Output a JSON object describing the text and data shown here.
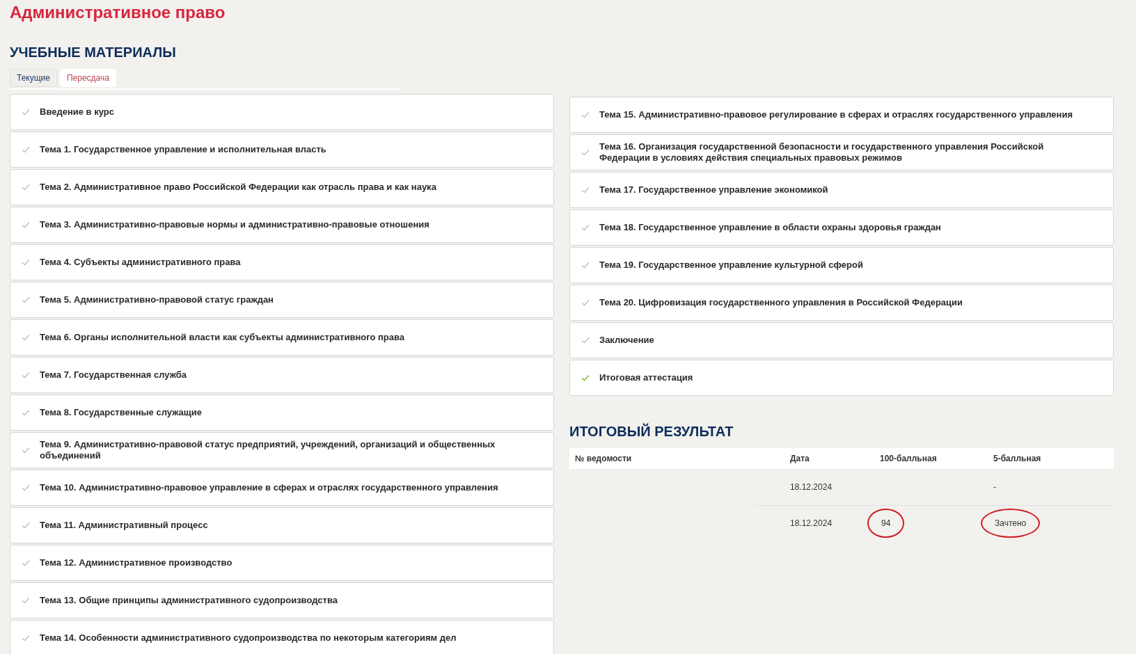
{
  "page_title": "Административное право",
  "materials": {
    "heading": "УЧЕБНЫЕ МАТЕРИАЛЫ",
    "tabs": [
      {
        "label": "Текущие",
        "selected": false
      },
      {
        "label": "Пересдача",
        "selected": true
      }
    ],
    "left_items": [
      {
        "title": "Введение в курс",
        "completed": false
      },
      {
        "title": "Тема 1. Государственное управление и исполнительная власть",
        "completed": false
      },
      {
        "title": "Тема 2. Административное право Российской Федерации как отрасль права и как наука",
        "completed": false
      },
      {
        "title": "Тема 3. Административно-правовые нормы и административно-правовые отношения",
        "completed": false
      },
      {
        "title": "Тема 4. Субъекты административного права",
        "completed": false
      },
      {
        "title": "Тема 5. Административно-правовой статус граждан",
        "completed": false
      },
      {
        "title": "Тема 6. Органы исполнительной власти как субъекты административного права",
        "completed": false
      },
      {
        "title": "Тема 7. Государственная служба",
        "completed": false
      },
      {
        "title": "Тема 8. Государственные служащие",
        "completed": false
      },
      {
        "title": "Тема 9. Административно-правовой статус предприятий, учреждений, организаций и общественных объединений",
        "completed": false
      },
      {
        "title": "Тема 10. Административно-правовое управление в сферах и отраслях государственного управления",
        "completed": false
      },
      {
        "title": "Тема 11. Административный процесс",
        "completed": false
      },
      {
        "title": "Тема 12. Административное производство",
        "completed": false
      },
      {
        "title": "Тема 13. Общие принципы административного судопроизводства",
        "completed": false
      },
      {
        "title": "Тема 14. Особенности административного судопроизводства по некоторым категориям дел",
        "completed": false
      }
    ],
    "right_items": [
      {
        "title": "Тема 15. Административно-правовое регулирование в сферах и отраслях государственного управления",
        "completed": false
      },
      {
        "title": "Тема 16. Организация государственной безопасности и государственного управления Российской Федерации в условиях действия специальных правовых режимов",
        "completed": false
      },
      {
        "title": "Тема 17. Государственное управление экономикой",
        "completed": false
      },
      {
        "title": "Тема 18. Государственное управление в области охраны здоровья граждан",
        "completed": false
      },
      {
        "title": "Тема 19. Государственное управление культурной сферой",
        "completed": false
      },
      {
        "title": "Тема 20. Цифровизация государственного управления в Российской Федерации",
        "completed": false
      },
      {
        "title": "Заключение",
        "completed": false
      },
      {
        "title": "Итоговая аттестация",
        "completed": true
      }
    ]
  },
  "result": {
    "heading": "ИТОГОВЫЙ РЕЗУЛЬТАТ",
    "columns": [
      "№ ведомости",
      "Дата",
      "100-балльная",
      "5-балльная"
    ],
    "rows": [
      {
        "date": "18.12.2024",
        "score_5": "-",
        "circled": false
      },
      {
        "date": "18.12.2024",
        "score_100": "94",
        "score_5": "Зачтено",
        "circled": true
      }
    ]
  }
}
